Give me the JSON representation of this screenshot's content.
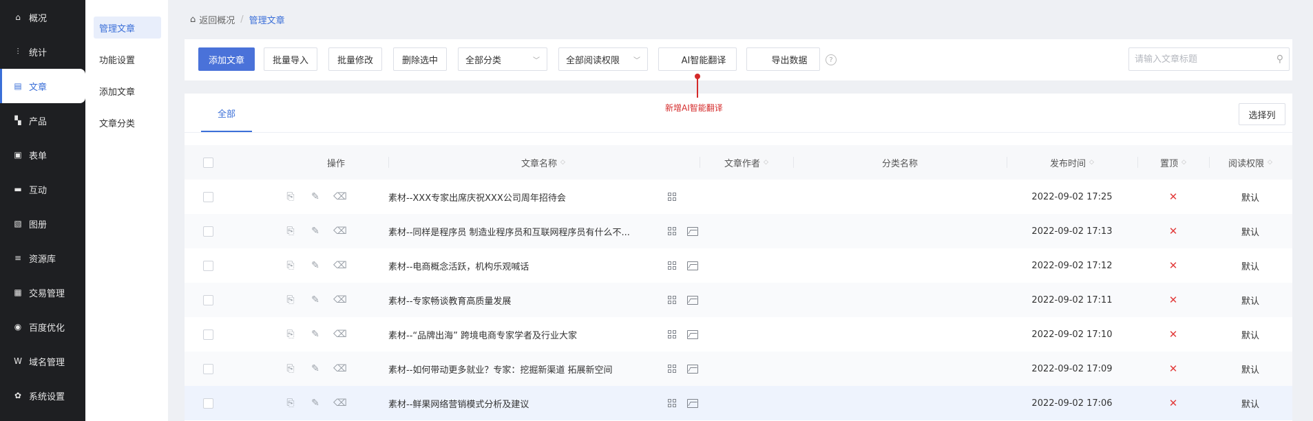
{
  "sidebar": {
    "items": [
      {
        "label": "概况",
        "icon": "home-icon",
        "glyph": "⌂"
      },
      {
        "label": "统计",
        "icon": "stats-icon",
        "glyph": "⫶"
      },
      {
        "label": "文章",
        "icon": "article-icon",
        "glyph": "▤",
        "active": true
      },
      {
        "label": "产品",
        "icon": "product-icon",
        "glyph": "▚"
      },
      {
        "label": "表单",
        "icon": "form-icon",
        "glyph": "▣"
      },
      {
        "label": "互动",
        "icon": "chat-icon",
        "glyph": "▬"
      },
      {
        "label": "图册",
        "icon": "album-icon",
        "glyph": "▧"
      },
      {
        "label": "资源库",
        "icon": "database-icon",
        "glyph": "≡"
      },
      {
        "label": "交易管理",
        "icon": "trade-icon",
        "glyph": "▦"
      },
      {
        "label": "百度优化",
        "icon": "seo-icon",
        "glyph": "◉"
      },
      {
        "label": "域名管理",
        "icon": "domain-icon",
        "glyph": "W"
      },
      {
        "label": "系统设置",
        "icon": "gear-icon",
        "glyph": "✿"
      }
    ]
  },
  "subnav": {
    "items": [
      {
        "label": "管理文章",
        "active": true
      },
      {
        "label": "功能设置"
      },
      {
        "label": "添加文章"
      },
      {
        "label": "文章分类"
      }
    ]
  },
  "breadcrumb": {
    "back": "返回概况",
    "sep": "/",
    "current": "管理文章"
  },
  "toolbar": {
    "add": "添加文章",
    "batch_import": "批量导入",
    "batch_edit": "批量修改",
    "delete_selected": "删除选中",
    "category_select": "全部分类",
    "permission_select": "全部阅读权限",
    "ai_translate": "AI智能翻译",
    "export": "导出数据",
    "help": "?",
    "search_placeholder": "请输入文章标题"
  },
  "annotation": {
    "text": "新增AI智能翻译",
    "color": "#d42a2a"
  },
  "tabs": {
    "all": "全部",
    "choose_columns": "选择列"
  },
  "table": {
    "headers": {
      "ops": "操作",
      "title": "文章名称",
      "author": "文章作者",
      "category": "分类名称",
      "date": "发布时间",
      "top": "置顶",
      "perm": "阅读权限"
    },
    "rows": [
      {
        "title": "素材--XXX专家出席庆祝XXX公司周年招待会",
        "date": "2022-09-02 17:25",
        "top": "✕",
        "perm": "默认",
        "has_image": false
      },
      {
        "title": "素材--同样是程序员 制造业程序员和互联网程序员有什么不...",
        "date": "2022-09-02 17:13",
        "top": "✕",
        "perm": "默认",
        "has_image": true
      },
      {
        "title": "素材--电商概念活跃，机构乐观喊话",
        "date": "2022-09-02 17:12",
        "top": "✕",
        "perm": "默认",
        "has_image": true
      },
      {
        "title": "素材--专家畅谈教育高质量发展",
        "date": "2022-09-02 17:11",
        "top": "✕",
        "perm": "默认",
        "has_image": true
      },
      {
        "title": "素材--“品牌出海” 跨境电商专家学者及行业大家",
        "date": "2022-09-02 17:10",
        "top": "✕",
        "perm": "默认",
        "has_image": true
      },
      {
        "title": "素材--如何带动更多就业？专家：挖掘新渠道 拓展新空间",
        "date": "2022-09-02 17:09",
        "top": "✕",
        "perm": "默认",
        "has_image": true
      },
      {
        "title": "素材--鲜果网络营销模式分析及建议",
        "date": "2022-09-02 17:06",
        "top": "✕",
        "perm": "默认",
        "has_image": true
      }
    ]
  },
  "colors": {
    "accent": "#3b6fd8",
    "primary_button": "#4a72d9",
    "sidebar_bg": "#1e1f22",
    "danger": "#e23b3b"
  }
}
